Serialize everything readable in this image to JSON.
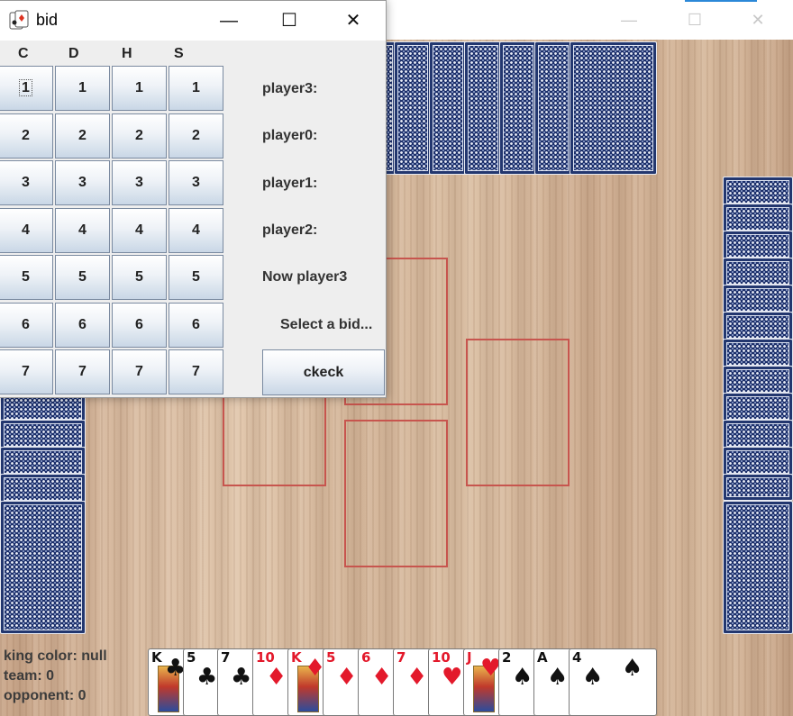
{
  "main_window": {
    "controls": {
      "minimize": "—",
      "maximize": "☐",
      "close": "✕"
    }
  },
  "bid_dialog": {
    "title": "bid",
    "controls": {
      "minimize": "—",
      "maximize": "☐",
      "close": "✕"
    },
    "suits": [
      "C",
      "D",
      "H",
      "S"
    ],
    "bid_values": [
      "1",
      "2",
      "3",
      "4",
      "5",
      "6",
      "7"
    ],
    "players": [
      "player3:",
      "player0:",
      "player1:",
      "player2:"
    ],
    "turn_text": "Now player3",
    "prompt_text": "Select a bid...",
    "check_button": "ckeck"
  },
  "status": {
    "king_color": "king color: null",
    "team": "team: 0",
    "opponent": "opponent: 0"
  },
  "hand": [
    {
      "rank": "K",
      "suit": "♣",
      "color": "blk",
      "court": true
    },
    {
      "rank": "5",
      "suit": "♣",
      "color": "blk",
      "court": false
    },
    {
      "rank": "7",
      "suit": "♣",
      "color": "blk",
      "court": false
    },
    {
      "rank": "10",
      "suit": "♦",
      "color": "red",
      "court": false
    },
    {
      "rank": "K",
      "suit": "♦",
      "color": "red",
      "court": true
    },
    {
      "rank": "5",
      "suit": "♦",
      "color": "red",
      "court": false
    },
    {
      "rank": "6",
      "suit": "♦",
      "color": "red",
      "court": false
    },
    {
      "rank": "7",
      "suit": "♦",
      "color": "red",
      "court": false
    },
    {
      "rank": "10",
      "suit": "♥",
      "color": "red",
      "court": false
    },
    {
      "rank": "J",
      "suit": "♥",
      "color": "red",
      "court": true
    },
    {
      "rank": "2",
      "suit": "♠",
      "color": "blk",
      "court": false
    },
    {
      "rank": "A",
      "suit": "♠",
      "color": "blk",
      "court": false
    },
    {
      "rank": "4",
      "suit": "♠",
      "color": "blk",
      "court": false
    }
  ],
  "colors": {
    "table": "#d6b89c",
    "card_back": "#1c2f6a",
    "slot_border": "#c7554e",
    "accent": "#2b88d8"
  }
}
